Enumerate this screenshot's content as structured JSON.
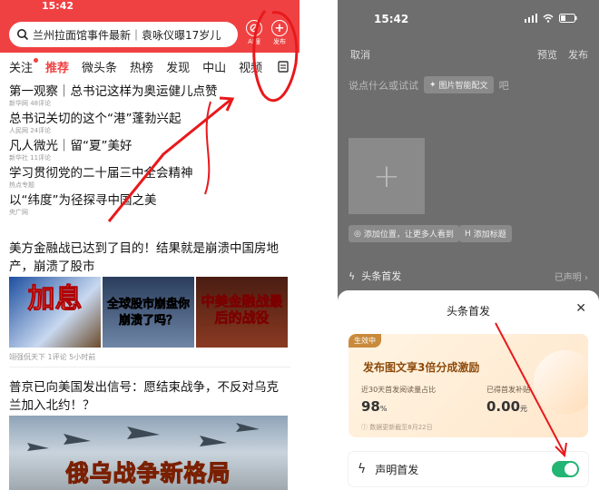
{
  "left": {
    "status_time": "15:42",
    "search_text": "兰州拉面馆事件最新｜袁咏仪曝17岁儿",
    "ai_label": "AI搜",
    "publish_label": "发布",
    "tabs": [
      "关注",
      "推荐",
      "微头条",
      "热榜",
      "发现",
      "中山",
      "视频"
    ],
    "hot_items": [
      {
        "title": "第一观察｜总书记这样为奥运健儿点赞",
        "meta": "新华网  48评论"
      },
      {
        "title": "总书记关切的这个“港”蓬勃兴起",
        "meta": "人民网  24评论"
      },
      {
        "title": "凡人微光｜留“夏”美好",
        "meta": "新华社  11评论"
      },
      {
        "title": "学习贯彻党的二十届三中全会精神",
        "meta": "热点专题"
      },
      {
        "title": "以“纬度”为径探寻中国之美",
        "meta": "央广网"
      }
    ],
    "article1": {
      "title": "美方金融战已达到了目的！结果就是崩溃中国房地产，崩溃了股市",
      "img1_caption": "加息",
      "img2_caption": "全球股市崩盘你崩溃了吗？",
      "img3_caption": "中美金融战最后的战役",
      "meta": "翊强侃天下  1评论  5小时前"
    },
    "article2": {
      "title": "普京已向美国发出信号：愿结束战争，不反对乌克兰加入北约！？",
      "image_caption": "俄乌战争新格局"
    }
  },
  "right": {
    "status_time": "15:42",
    "cancel": "取消",
    "preview": "预览",
    "publish": "发布",
    "placeholder": "说点什么或试试",
    "smart_chip": "图片智能配文",
    "placeholder_tail": "吧",
    "add_location": "添加位置，让更多人看到",
    "add_tag": "添加标题",
    "first_publish_row": "头条首发",
    "first_publish_status": "已声明",
    "sheet": {
      "title": "头条首发",
      "badge": "生效中",
      "headline": "发布图文享3倍分成激励",
      "stat1_label": "近30天首发阅读量占比",
      "stat1_value": "98",
      "stat1_unit": "%",
      "stat2_label": "已得首发补贴",
      "stat2_value": "0.00",
      "stat2_unit": "元",
      "footer": "数据更新截至8月22日",
      "declare_label": "声明首发",
      "declare_on": true
    }
  },
  "colors": {
    "brand_red": "#f04142",
    "toggle_green": "#22b573",
    "annotation": "#e8191c"
  }
}
